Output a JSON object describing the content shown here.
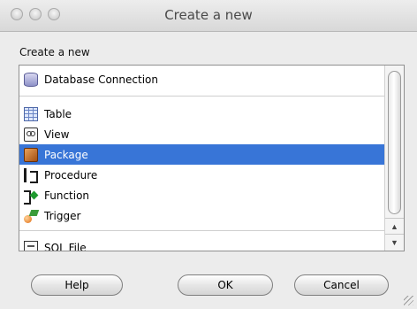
{
  "window": {
    "title": "Create a new"
  },
  "section": {
    "label": "Create a new"
  },
  "list": {
    "items": [
      {
        "label": "Database Connection",
        "icon": "database-icon",
        "selected": false
      },
      {
        "label": "Table",
        "icon": "table-icon",
        "selected": false
      },
      {
        "label": "View",
        "icon": "view-icon",
        "selected": false
      },
      {
        "label": "Package",
        "icon": "package-icon",
        "selected": true
      },
      {
        "label": "Procedure",
        "icon": "procedure-icon",
        "selected": false
      },
      {
        "label": "Function",
        "icon": "function-icon",
        "selected": false
      },
      {
        "label": "Trigger",
        "icon": "trigger-icon",
        "selected": false
      },
      {
        "label": "SQL File",
        "icon": "sql-file-icon",
        "selected": false
      }
    ]
  },
  "scrollbar": {
    "up_glyph": "▲",
    "down_glyph": "▼"
  },
  "buttons": {
    "help": "Help",
    "ok": "OK",
    "cancel": "Cancel"
  },
  "colors": {
    "selection": "#3875d7",
    "window_bg": "#ececec"
  }
}
